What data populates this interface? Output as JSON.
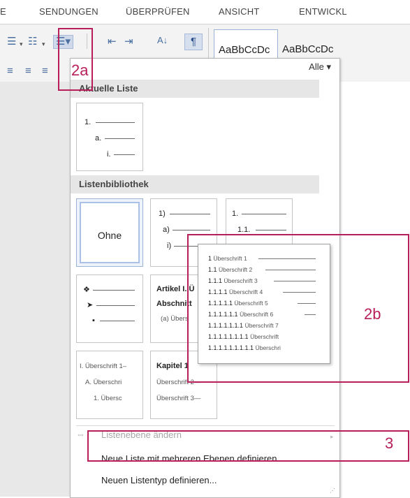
{
  "ribbon": {
    "tabs": [
      "E",
      "SENDUNGEN",
      "ÜBERPRÜFEN",
      "ANSICHT",
      "ENTWICKL"
    ],
    "style_samples": [
      "AaBbCcDc",
      "AaBbCcDc"
    ],
    "pilcrow": "¶"
  },
  "dropdown": {
    "filter_label": "Alle ▾",
    "current_list_header": "Aktuelle Liste",
    "current_list_levels": [
      "1.",
      "a.",
      "i."
    ],
    "library_header": "Listenbibliothek",
    "cards": [
      {
        "kind": "none",
        "label": "Ohne"
      },
      {
        "kind": "levels",
        "lines": [
          "1)",
          "a)",
          "i)"
        ]
      },
      {
        "kind": "levels",
        "lines": [
          "1.",
          "1.1."
        ]
      },
      {
        "kind": "bullets",
        "lines": [
          "❖",
          "➤",
          "▪"
        ]
      },
      {
        "kind": "artikel",
        "lines": [
          "Artikel I. Ü",
          "Abschnitt",
          "(a) Übers"
        ]
      },
      {
        "kind": "heading",
        "lines": [
          "I. Überschrift 1–",
          "A. Überschri",
          "1. Übersc"
        ]
      },
      {
        "kind": "kapitel",
        "lines": [
          "Kapitel 1",
          "Überschrift 2—",
          "Überschrift 3—"
        ]
      }
    ],
    "menu": {
      "change_level": "Listenebene ändern",
      "define_multilevel": "Neue Liste mit mehreren Ebenen definieren...",
      "define_list_style": "Neuen Listentyp definieren..."
    }
  },
  "preview": {
    "rows": [
      {
        "num": "1",
        "text": "Überschrift 1"
      },
      {
        "num": "1.1",
        "text": "Überschrift 2"
      },
      {
        "num": "1.1.1",
        "text": "Überschrift 3"
      },
      {
        "num": "1.1.1.1",
        "text": "Überschrift 4"
      },
      {
        "num": "1.1.1.1.1",
        "text": "Überschrift 5"
      },
      {
        "num": "1.1.1.1.1.1",
        "text": "Überschrift 6"
      },
      {
        "num": "1.1.1.1.1.1.1",
        "text": "Überschrift 7"
      },
      {
        "num": "1.1.1.1.1.1.1.1",
        "text": "Überschrift"
      },
      {
        "num": "1.1.1.1.1.1.1.1.1",
        "text": "Überschri"
      }
    ]
  },
  "annotations": {
    "label_2a": "2a",
    "label_2b": "2b",
    "label_3": "3",
    "color": "#b81f5a"
  }
}
